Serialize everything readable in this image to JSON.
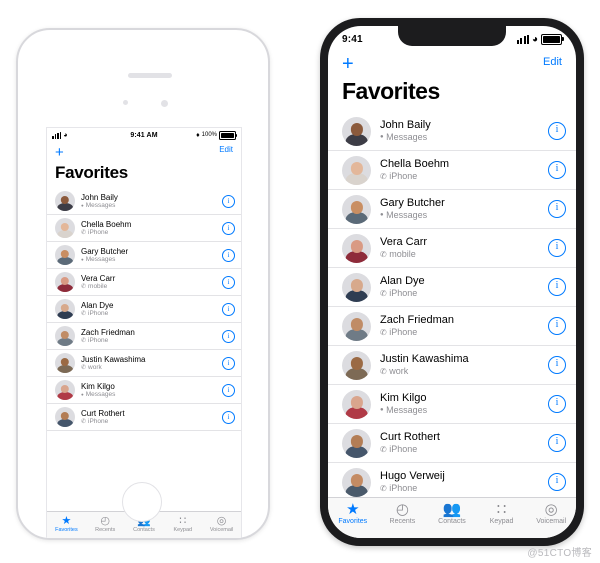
{
  "left_phone": {
    "status_bar": {
      "signal_icon": "signal-bars-icon",
      "wifi_icon": "wifi-icon",
      "time": "9:41 AM",
      "bluetooth_icon": "bluetooth-icon",
      "battery_percent": "100%",
      "battery_icon": "battery-icon"
    },
    "nav": {
      "add_label": "+",
      "edit_label": "Edit"
    },
    "title": "Favorites",
    "rows": [
      {
        "name": "John Baily",
        "type_icon": "dot-icon",
        "type": "Messages"
      },
      {
        "name": "Chella Boehm",
        "type_icon": "phone-icon",
        "type": "iPhone"
      },
      {
        "name": "Gary Butcher",
        "type_icon": "dot-icon",
        "type": "Messages"
      },
      {
        "name": "Vera Carr",
        "type_icon": "phone-icon",
        "type": "mobile"
      },
      {
        "name": "Alan Dye",
        "type_icon": "phone-icon",
        "type": "iPhone"
      },
      {
        "name": "Zach Friedman",
        "type_icon": "phone-icon",
        "type": "iPhone"
      },
      {
        "name": "Justin Kawashima",
        "type_icon": "phone-icon",
        "type": "work"
      },
      {
        "name": "Kim Kilgo",
        "type_icon": "dot-icon",
        "type": "Messages"
      },
      {
        "name": "Curt Rothert",
        "type_icon": "phone-icon",
        "type": "iPhone"
      }
    ],
    "info_label": "i",
    "tabs": [
      {
        "icon": "star-icon",
        "label": "Favorites",
        "active": true
      },
      {
        "icon": "clock-icon",
        "label": "Recents",
        "active": false
      },
      {
        "icon": "contacts-icon",
        "label": "Contacts",
        "active": false
      },
      {
        "icon": "keypad-icon",
        "label": "Keypad",
        "active": false
      },
      {
        "icon": "voicemail-icon",
        "label": "Voicemail",
        "active": false
      }
    ]
  },
  "right_phone": {
    "status_bar": {
      "time": "9:41",
      "signal_icon": "signal-bars-icon",
      "wifi_icon": "wifi-icon",
      "battery_icon": "battery-icon"
    },
    "nav": {
      "add_label": "+",
      "edit_label": "Edit"
    },
    "title": "Favorites",
    "rows": [
      {
        "name": "John Baily",
        "type_icon": "dot-icon",
        "type": "Messages"
      },
      {
        "name": "Chella Boehm",
        "type_icon": "phone-icon",
        "type": "iPhone"
      },
      {
        "name": "Gary Butcher",
        "type_icon": "dot-icon",
        "type": "Messages"
      },
      {
        "name": "Vera Carr",
        "type_icon": "phone-icon",
        "type": "mobile"
      },
      {
        "name": "Alan Dye",
        "type_icon": "phone-icon",
        "type": "iPhone"
      },
      {
        "name": "Zach Friedman",
        "type_icon": "phone-icon",
        "type": "iPhone"
      },
      {
        "name": "Justin Kawashima",
        "type_icon": "phone-icon",
        "type": "work"
      },
      {
        "name": "Kim Kilgo",
        "type_icon": "dot-icon",
        "type": "Messages"
      },
      {
        "name": "Curt Rothert",
        "type_icon": "phone-icon",
        "type": "iPhone"
      },
      {
        "name": "Hugo Verweij",
        "type_icon": "phone-icon",
        "type": "iPhone"
      }
    ],
    "info_label": "i",
    "tabs": [
      {
        "icon": "star-icon",
        "label": "Favorites",
        "active": true
      },
      {
        "icon": "clock-icon",
        "label": "Recents",
        "active": false
      },
      {
        "icon": "contacts-icon",
        "label": "Contacts",
        "active": false
      },
      {
        "icon": "keypad-icon",
        "label": "Keypad",
        "active": false
      },
      {
        "icon": "voicemail-icon",
        "label": "Voicemail",
        "active": false
      }
    ]
  },
  "watermark": "@51CTO博客",
  "colors": {
    "accent": "#007aff",
    "secondary_text": "#8e8e93",
    "separator": "#e3e3e6",
    "tabbar_bg": "#f8f8f8",
    "device_frame": "#1c1c1e"
  }
}
